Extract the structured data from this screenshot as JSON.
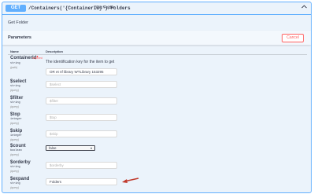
{
  "operation": {
    "method": "GET",
    "path": "/Containers('{ContainerId}')/Folders",
    "summary": "Get Folder",
    "description": "Get Folder",
    "collapse_icon": "chevron-up-icon"
  },
  "parameters_section": {
    "title": "Parameters",
    "cancel_label": "Cancel",
    "col_name": "Name",
    "col_description": "Description"
  },
  "params": [
    {
      "name": "ContainerId",
      "required_star": "*",
      "required_text": "required",
      "type": "string",
      "in": "(path)",
      "description": "The identification key for the item to get",
      "value": "OR et nf library WTLibrary 153295",
      "placeholder": ""
    },
    {
      "name": "$select",
      "type": "string",
      "in": "(query)",
      "value": "",
      "placeholder": "$select"
    },
    {
      "name": "$filter",
      "type": "string",
      "in": "(query)",
      "value": "",
      "placeholder": "$filter"
    },
    {
      "name": "$top",
      "type": "integer",
      "in": "(query)",
      "value": "",
      "placeholder": "$top"
    },
    {
      "name": "$skip",
      "type": "integer",
      "in": "(query)",
      "value": "",
      "placeholder": "$skip"
    },
    {
      "name": "$count",
      "type": "boolean",
      "in": "(query)",
      "selected": "false",
      "caret": "▾"
    },
    {
      "name": "$orderby",
      "type": "string",
      "in": "(query)",
      "value": "",
      "placeholder": "$orderby"
    },
    {
      "name": "$expand",
      "type": "string",
      "in": "(query)",
      "value": "Folders",
      "placeholder": ""
    }
  ],
  "colors": {
    "method_get": "#61affe",
    "cancel": "#ff6060",
    "arrow": "#c0392b"
  }
}
